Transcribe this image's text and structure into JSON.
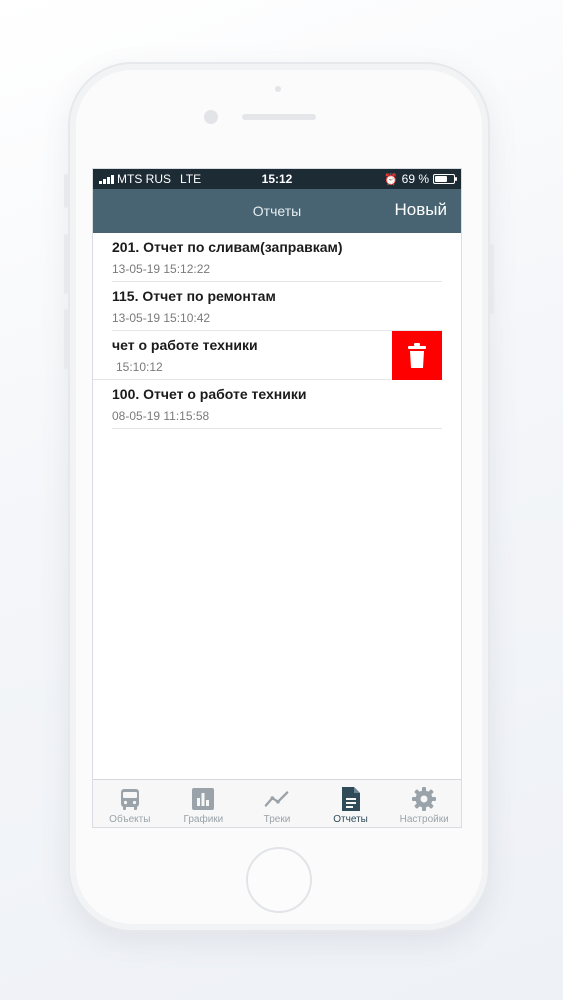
{
  "status_bar": {
    "carrier": "MTS RUS",
    "network": "LTE",
    "time": "15:12",
    "battery": "69 %",
    "battery_level": 0.69
  },
  "nav": {
    "title": "Отчеты",
    "new_button": "Новый"
  },
  "reports": [
    {
      "title": "201. Отчет по сливам(заправкам)",
      "date": "13-05-19 15:12:22"
    },
    {
      "title": "115. Отчет по ремонтам",
      "date": "13-05-19 15:10:42"
    },
    {
      "title": "чет о работе техники",
      "date": "15:10:12",
      "swiped": true
    },
    {
      "title": "100. Отчет о работе техники",
      "date": "08-05-19 11:15:58"
    }
  ],
  "tabs": [
    {
      "label": "Объекты",
      "icon": "bus-icon"
    },
    {
      "label": "Графики",
      "icon": "bar-chart-icon"
    },
    {
      "label": "Треки",
      "icon": "track-line-icon"
    },
    {
      "label": "Отчеты",
      "icon": "document-icon",
      "active": true
    },
    {
      "label": "Настройки",
      "icon": "gear-icon"
    }
  ],
  "colors": {
    "nav_bar": "#486472",
    "status_bar": "#1d2b35",
    "delete": "#ff0000",
    "tab_active": "#2f4a58",
    "tab_inactive": "#9aa3a9"
  }
}
